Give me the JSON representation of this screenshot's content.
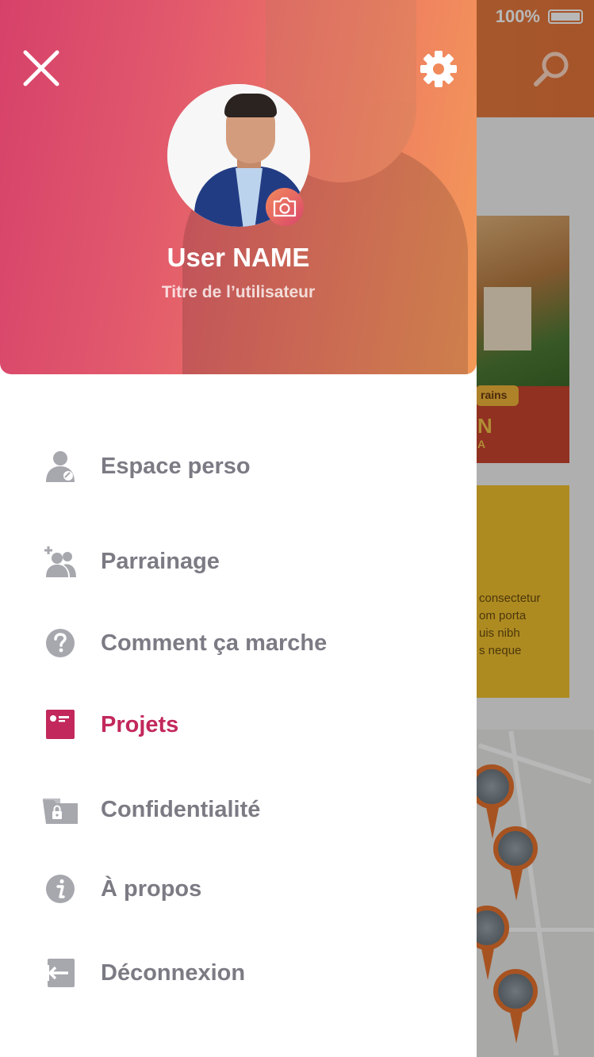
{
  "background": {
    "status_battery": "100%",
    "card1": {
      "tag": "rains",
      "big": "N",
      "small": "A"
    },
    "card2": {
      "lines": [
        "consectetur",
        "om porta",
        "uis nibh",
        "s neque"
      ]
    }
  },
  "drawer": {
    "user": {
      "name": "User NAME",
      "title": "Titre de l’utilisateur"
    },
    "menu": [
      {
        "label": "Espace perso",
        "icon": "user-icon",
        "active": false
      },
      {
        "label": "Parrainage",
        "icon": "add-users-icon",
        "active": false
      },
      {
        "label": "Comment ça marche",
        "icon": "help-icon",
        "active": false
      },
      {
        "label": "Projets",
        "icon": "project-card-icon",
        "active": true
      },
      {
        "label": "Confidentialité",
        "icon": "locked-folder-icon",
        "active": false
      },
      {
        "label": "À propos",
        "icon": "info-icon",
        "active": false
      },
      {
        "label": "Déconnexion",
        "icon": "logout-icon",
        "active": false
      }
    ]
  },
  "colors": {
    "header_gradient_start": "#d6416a",
    "header_gradient_end": "#f39a58",
    "menu_text": "#7c7b84",
    "menu_icon": "#a7a7ae",
    "active": "#c2285c"
  }
}
